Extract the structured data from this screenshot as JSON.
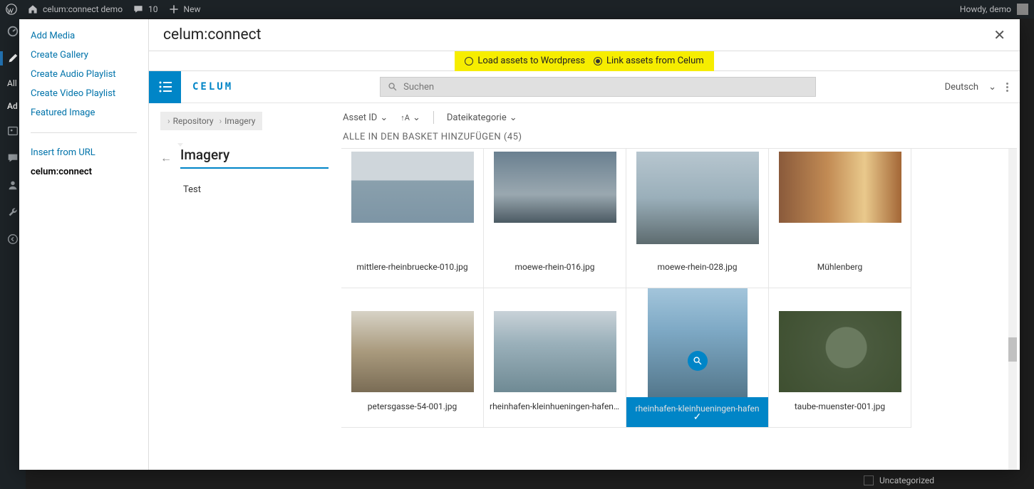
{
  "admin_bar": {
    "site_name": "celum:connect demo",
    "comments": "10",
    "new": "New",
    "howdy": "Howdy, demo"
  },
  "wp_side_labels": {
    "all": "All",
    "ad": "Ad"
  },
  "media_menu": {
    "items": [
      "Add Media",
      "Create Gallery",
      "Create Audio Playlist",
      "Create Video Playlist",
      "Featured Image"
    ],
    "insert_url": "Insert from URL",
    "celum": "celum:connect"
  },
  "modal": {
    "title": "celum:connect",
    "opt_load": "Load assets to Wordpress",
    "opt_link": "Link assets from Celum"
  },
  "celum": {
    "search_placeholder": "Suchen",
    "lang": "Deutsch",
    "breadcrumb": {
      "root": "Repository",
      "current": "Imagery"
    },
    "folder_title": "Imagery",
    "subfolder": "Test",
    "toolbar": {
      "asset_id": "Asset ID",
      "file_cat": "Dateikategorie"
    },
    "basket_all": "ALLE IN DEN BASKET HINZUFÜGEN (45)",
    "assets": [
      {
        "name": "mittlere-rheinbruecke-010.jpg",
        "img": "img-a"
      },
      {
        "name": "moewe-rhein-016.jpg",
        "img": "img-b"
      },
      {
        "name": "moewe-rhein-028.jpg",
        "img": "img-c"
      },
      {
        "name": "Mühlenberg",
        "img": "img-d"
      },
      {
        "name": "petersgasse-54-001.jpg",
        "img": "img-e"
      },
      {
        "name": "rheinhafen-kleinhueningen-hafen...",
        "img": "img-f"
      },
      {
        "name": "rheinhafen-kleinhueningen-hafen",
        "img": "img-g",
        "selected": true
      },
      {
        "name": "taube-muenster-001.jpg",
        "img": "img-h"
      }
    ]
  },
  "footer": {
    "uncategorized": "Uncategorized"
  }
}
